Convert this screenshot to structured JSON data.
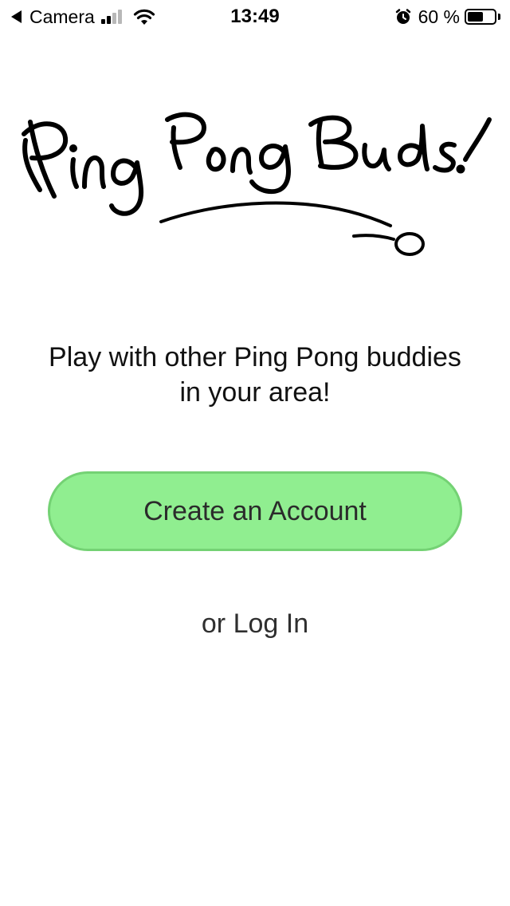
{
  "status_bar": {
    "back_app": "Camera",
    "time": "13:49",
    "battery_percent": "60 %",
    "battery_level": 0.6,
    "signal_bars_filled": 2,
    "signal_bars_total": 4
  },
  "logo": {
    "text": "Ping Pong Buds!",
    "icon": "ping-pong-ball-icon"
  },
  "main": {
    "tagline_line1": "Play with other Ping Pong buddies",
    "tagline_line2": "in your area!",
    "create_account_label": "Create an Account",
    "login_label": "or Log In"
  },
  "colors": {
    "button_fill": "#90ee90",
    "button_border": "#74d274",
    "text": "#111111"
  }
}
